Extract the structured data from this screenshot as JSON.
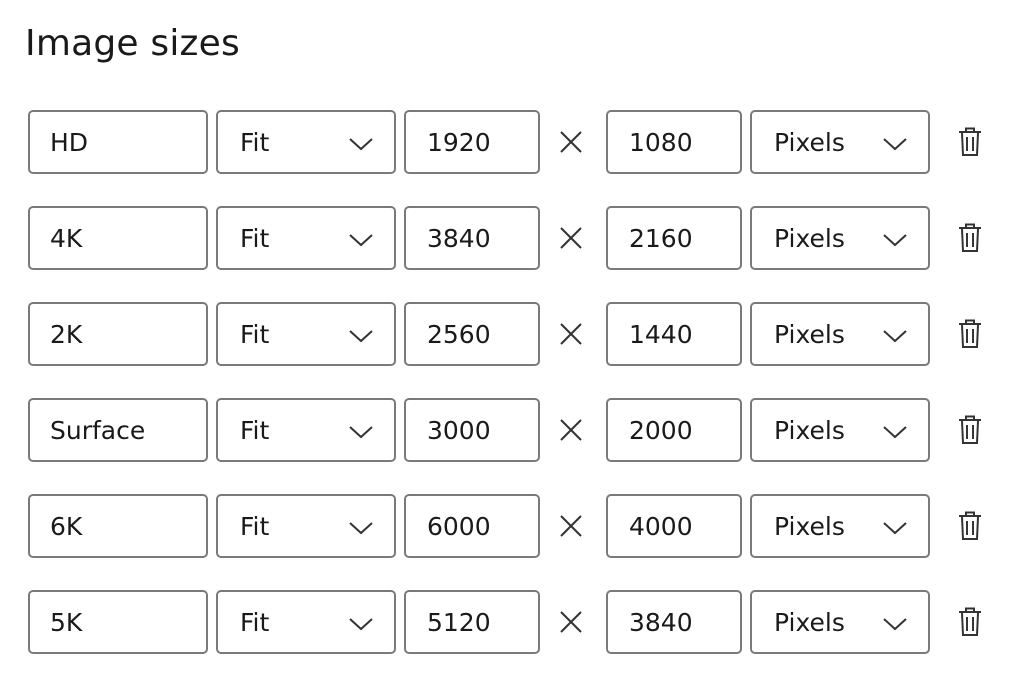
{
  "title": "Image sizes",
  "times_symbol": "×",
  "rows": [
    {
      "name": "HD",
      "fit": "Fit",
      "width": "1920",
      "height": "1080",
      "unit": "Pixels"
    },
    {
      "name": "4K",
      "fit": "Fit",
      "width": "3840",
      "height": "2160",
      "unit": "Pixels"
    },
    {
      "name": "2K",
      "fit": "Fit",
      "width": "2560",
      "height": "1440",
      "unit": "Pixels"
    },
    {
      "name": "Surface",
      "fit": "Fit",
      "width": "3000",
      "height": "2000",
      "unit": "Pixels"
    },
    {
      "name": "6K",
      "fit": "Fit",
      "width": "6000",
      "height": "4000",
      "unit": "Pixels"
    },
    {
      "name": "5K",
      "fit": "Fit",
      "width": "5120",
      "height": "3840",
      "unit": "Pixels"
    }
  ],
  "icons": {
    "dropdown": "chevron-down-icon",
    "multiply": "multiply-icon",
    "delete": "trash-icon"
  },
  "colors": {
    "border": "#7a7a7a",
    "text": "#1a1a1a",
    "icon": "#333333"
  }
}
